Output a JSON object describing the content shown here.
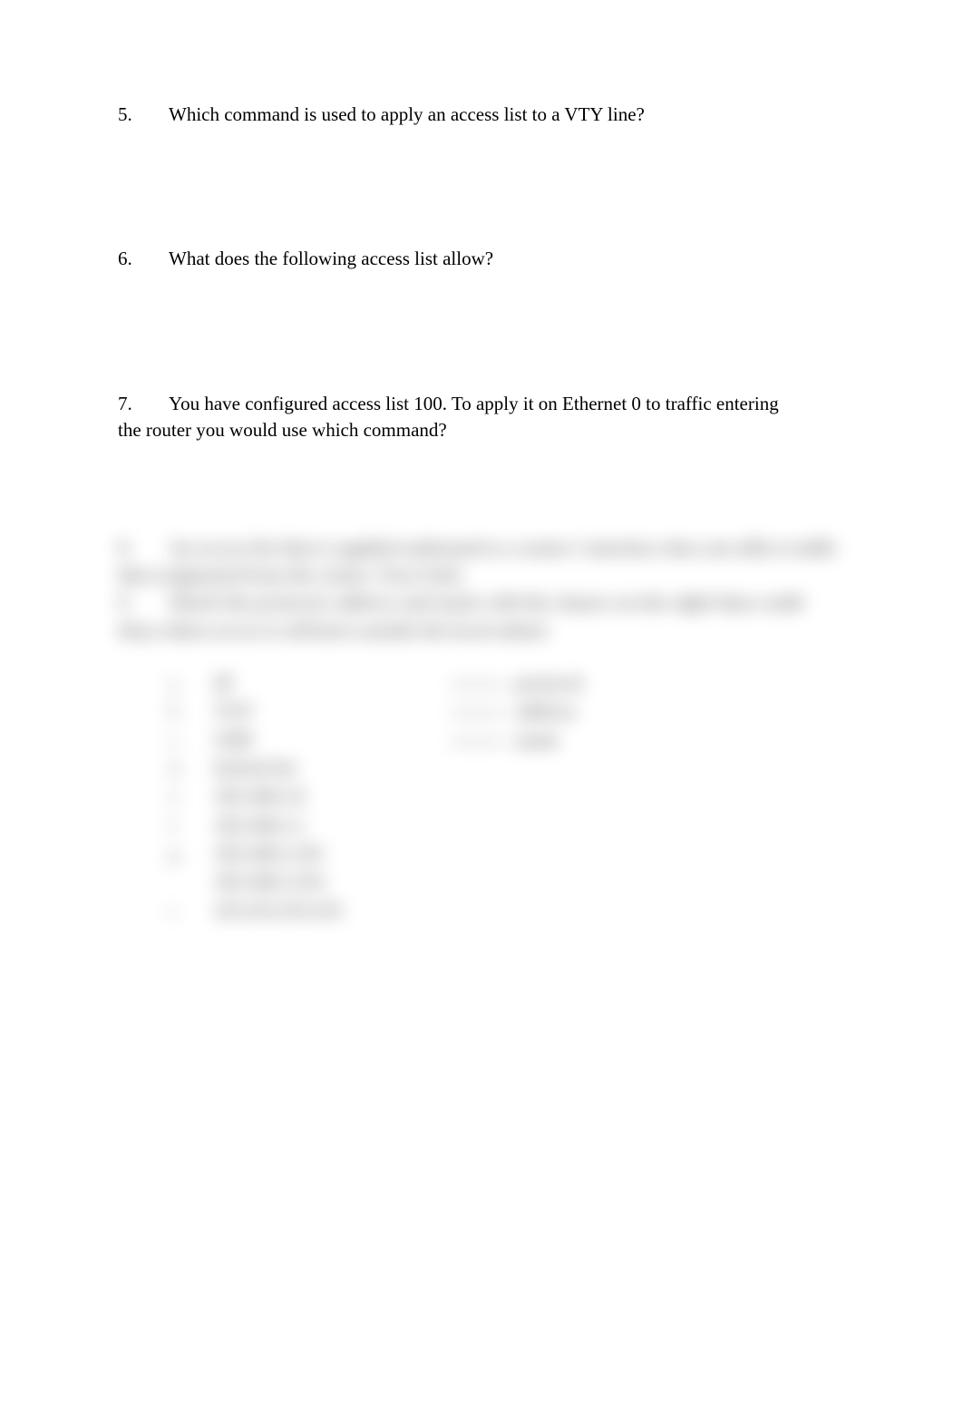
{
  "questions": {
    "q5": {
      "number": "5.",
      "text": "Which command is used to apply an access list to a VTY line?"
    },
    "q6": {
      "number": "6.",
      "text": "What does the following access list allow?"
    },
    "q7": {
      "number": "7.",
      "text_part1": "You have configured access list 100.  To apply it on Ethernet 0 to traffic entering",
      "text_part2": "the router you would use which command?"
    }
  },
  "blurred": {
    "q8": {
      "number": "8.",
      "text_part1": "An access list that is applied outbound to a router's interface does not affect traffic",
      "text_part2": "that originated from the router.   True      False"
    },
    "q9": {
      "number": "9.",
      "text_part1": "Match the protocol, address and mask with the clauses on the right than could",
      "text_part2": "deny telnet access to all hosts outside the local subnet"
    },
    "left_items": {
      "a": {
        "letter": "a.",
        "text": "IP"
      },
      "b": {
        "letter": "b.",
        "text": "TCP"
      },
      "c": {
        "letter": "c.",
        "text": "UDP"
      },
      "d": {
        "letter": "d.",
        "text": "0.0.0.0 0.0"
      },
      "e": {
        "letter": "e.",
        "text": "192.168.1.0"
      },
      "f": {
        "letter": "f.",
        "text": "192.168.1.1"
      },
      "g": {
        "letter": "g.",
        "text": "192.168.1.255"
      },
      "h": {
        "letter": "",
        "text": "192.168.1.254"
      },
      "i": {
        "letter": "i.",
        "text": "255.255.255.255"
      }
    },
    "right_items": {
      "r1": {
        "label": "protocol"
      },
      "r2": {
        "label": "address"
      },
      "r3": {
        "label": "mask"
      }
    }
  }
}
